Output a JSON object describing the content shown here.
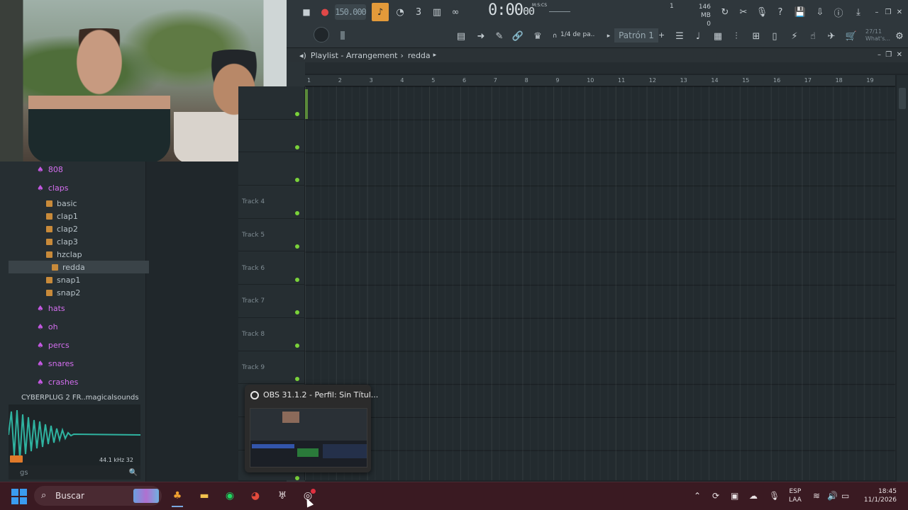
{
  "toolbar": {
    "bpm": "150.000",
    "time_main": "0:00",
    "time_sub": "00",
    "time_unit": "M:S:CS",
    "mem": "146 MB",
    "mem_sub": "0",
    "cpu_top": "1",
    "snap": "1/4 de pa..",
    "pattern": "Patrón 1",
    "pattern_add": "+",
    "news_date": "27/11",
    "news_label": "What's..."
  },
  "playlist": {
    "title": "Playlist - Arrangement",
    "breadcrumb": "redda",
    "ruler_ticks": [
      "1",
      "2",
      "3",
      "4",
      "5",
      "6",
      "7",
      "8",
      "9",
      "10",
      "11",
      "12",
      "13",
      "14",
      "15",
      "16",
      "17",
      "18",
      "19"
    ],
    "tracks": [
      "",
      "",
      "",
      "Track 4",
      "Track 5",
      "Track 6",
      "Track 7",
      "Track 8",
      "Track 9",
      "",
      "",
      ""
    ]
  },
  "browser": {
    "folders_top": [
      {
        "label": "808"
      },
      {
        "label": "claps"
      }
    ],
    "files": [
      {
        "label": "basic"
      },
      {
        "label": "clap1"
      },
      {
        "label": "clap2"
      },
      {
        "label": "clap3"
      },
      {
        "label": "hzclap"
      },
      {
        "label": "redda"
      },
      {
        "label": "snap1"
      },
      {
        "label": "snap2"
      }
    ],
    "folders_bottom": [
      {
        "label": "hats"
      },
      {
        "label": "oh"
      },
      {
        "label": "percs"
      },
      {
        "label": "snares"
      },
      {
        "label": "crashes"
      }
    ],
    "pack_label": "CYBERPLUG 2 FR..magicalsounds",
    "wave_info": "44.1 kHz 32",
    "search_text": "gs"
  },
  "obs_popup": {
    "title": "OBS 31.1.2 - Perfil: Sin Títul..."
  },
  "taskbar": {
    "search_placeholder": "Buscar",
    "lang_top": "ESP",
    "lang_bottom": "LAA",
    "time": "18:45",
    "date": "11/1/2026"
  },
  "colors": {
    "accent_orange": "#e39a3a",
    "folder_purple": "#d56ff0",
    "track_dot_green": "#7ad23a",
    "taskbar_bg": "#3a1a22"
  }
}
